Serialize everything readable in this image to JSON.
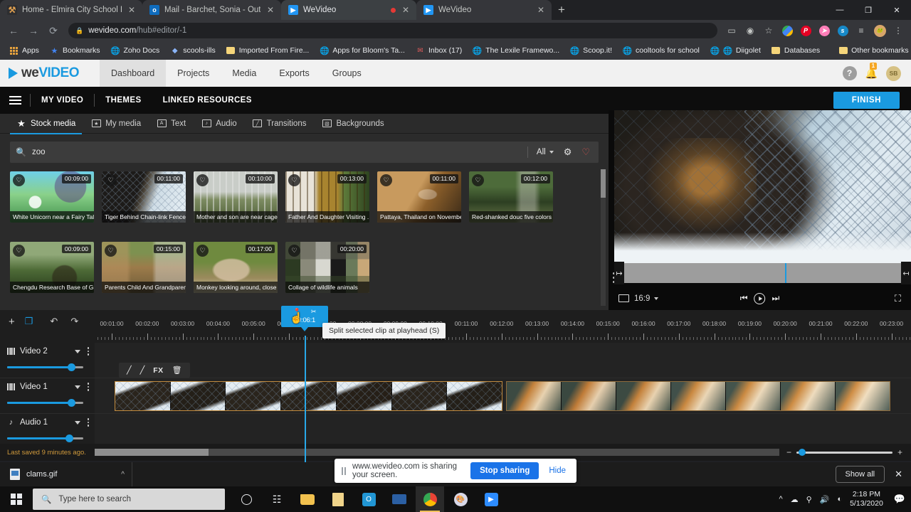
{
  "browser": {
    "tabs": [
      {
        "title": "Home - Elmira City School Distri",
        "favicon": "elmira-icon",
        "active": false,
        "recording": false
      },
      {
        "title": "Mail - Barchet, Sonia - Outlook",
        "favicon": "outlook-icon",
        "active": false,
        "recording": false
      },
      {
        "title": "WeVideo",
        "favicon": "wevideo-icon",
        "active": true,
        "recording": true
      },
      {
        "title": "WeVideo",
        "favicon": "wevideo-icon",
        "active": false,
        "recording": false
      }
    ],
    "new_tab_label": "+",
    "window_controls": {
      "minimize": "—",
      "maximize": "❐",
      "close": "✕"
    },
    "url_prefix": "wevideo.com",
    "url_suffix": "/hub#editor/-1",
    "bookmarks": [
      {
        "label": "Apps",
        "icon": "apps-grid-icon"
      },
      {
        "label": "Bookmarks",
        "icon": "star-icon"
      },
      {
        "label": "Zoho Docs",
        "icon": "globe-icon"
      },
      {
        "label": "scools-ills",
        "icon": "diamond-icon"
      },
      {
        "label": "Imported From Fire...",
        "icon": "folder-icon"
      },
      {
        "label": "Apps for Bloom's Ta...",
        "icon": "globe-icon"
      },
      {
        "label": "Inbox (17)",
        "icon": "mail-icon"
      },
      {
        "label": "The Lexile Framewo...",
        "icon": "globe-icon"
      },
      {
        "label": "Scoop.it!",
        "icon": "globe-icon"
      },
      {
        "label": "cooltools for school",
        "icon": "globe-icon"
      },
      {
        "label": "Diigolet",
        "icon": "globe-icon"
      },
      {
        "label": "Databases",
        "icon": "folder-icon"
      }
    ],
    "other_bookmarks": {
      "label": "Other bookmarks",
      "icon": "folder-icon"
    },
    "toolbar_extensions": [
      "cast-icon",
      "download-icon",
      "bookmark-star-icon",
      "google-drive-icon",
      "pinterest-icon",
      "pink-arrow-icon",
      "s-blue-icon",
      "list-icon",
      "profile-avatar-icon",
      "menu-dots-icon"
    ]
  },
  "wevideo": {
    "logo_we": "we",
    "logo_video": "VIDEO",
    "nav": [
      {
        "label": "Dashboard",
        "active": true
      },
      {
        "label": "Projects",
        "active": false
      },
      {
        "label": "Media",
        "active": false
      },
      {
        "label": "Exports",
        "active": false
      },
      {
        "label": "Groups",
        "active": false
      }
    ],
    "help_label": "?",
    "notification_count": "1",
    "avatar_initials": "SB",
    "subnav": [
      {
        "label": "MY VIDEO"
      },
      {
        "label": "THEMES"
      },
      {
        "label": "LINKED RESOURCES"
      }
    ],
    "finish_label": "FINISH",
    "media_tabs": [
      {
        "label": "Stock media",
        "icon": "star-icon",
        "active": true
      },
      {
        "label": "My media",
        "icon": "media-box-icon",
        "active": false
      },
      {
        "label": "Text",
        "icon": "text-a-icon",
        "active": false
      },
      {
        "label": "Audio",
        "icon": "music-note-icon",
        "active": false
      },
      {
        "label": "Transitions",
        "icon": "transitions-icon",
        "active": false
      },
      {
        "label": "Backgrounds",
        "icon": "image-icon",
        "active": false
      }
    ],
    "search": {
      "value": "zoo",
      "placeholder": "Search",
      "filter_label": "All",
      "icons": [
        "search-icon",
        "chevron-down-icon",
        "sliders-icon",
        "heart-icon"
      ]
    },
    "media_items": [
      {
        "title": "White Unicorn near a Fairy Tal...",
        "duration": "00:09:00"
      },
      {
        "title": "Tiger Behind Chain-link Fence",
        "duration": "00:11:00"
      },
      {
        "title": "Mother and son are near cage ...",
        "duration": "00:10:00"
      },
      {
        "title": "Father And Daughter Visiting ...",
        "duration": "00:13:00"
      },
      {
        "title": "Pattaya, Thailand on Novembe...",
        "duration": "00:11:00"
      },
      {
        "title": "Red-shanked douc five colors e...",
        "duration": "00:12:00"
      },
      {
        "title": "Chengdu Research Base of Gia...",
        "duration": "00:09:00"
      },
      {
        "title": "Parents Child And Grandparen...",
        "duration": "00:15:00"
      },
      {
        "title": "Monkey looking around, close ...",
        "duration": "00:17:00"
      },
      {
        "title": "Collage of wildlife animals",
        "duration": "00:20:00"
      }
    ],
    "preview": {
      "aspect_ratio": "16:9",
      "controls": [
        "prev-frame-icon",
        "play-icon",
        "next-frame-icon",
        "fullscreen-icon"
      ],
      "trim_in_icon": "trim-in-icon",
      "trim_out_icon": "trim-out-icon"
    },
    "timeline": {
      "toolbar_icons": [
        "add-icon",
        "duplicate-icon",
        "undo-icon",
        "redo-icon"
      ],
      "ruler_labels": [
        "00:01:00",
        "00:02:00",
        "00:03:00",
        "00:04:00",
        "00:05:00",
        "00:06:00",
        "00:07:00",
        "00:08:00",
        "00:09:00",
        "00:10:00",
        "00:11:00",
        "00:12:00",
        "00:13:00",
        "00:14:00",
        "00:15:00",
        "00:16:00",
        "00:17:00",
        "00:18:00",
        "00:19:00",
        "00:20:00",
        "00:21:00",
        "00:22:00",
        "00:23:00"
      ],
      "playhead_time": "00:06:1",
      "playhead_icons": [
        "marker-icon",
        "scissors-icon"
      ],
      "tooltip": "Split selected clip at playhead (S)",
      "tracks": [
        {
          "name": "Video 2",
          "icon": "video-track-icon",
          "volume": 78
        },
        {
          "name": "Video 1",
          "icon": "video-track-icon",
          "volume": 78
        },
        {
          "name": "Audio 1",
          "icon": "audio-track-icon",
          "volume": 76
        }
      ],
      "clip_toolbar": [
        "edit-pencil-icon",
        "trim-pencil-icon",
        "fx-label",
        "delete-trash-icon"
      ],
      "clip_fx_label": "FX",
      "saved_status": "Last saved 9 minutes ago.",
      "zoom_icons": [
        "zoom-out-icon",
        "zoom-in-icon"
      ]
    }
  },
  "share_bar": {
    "message": "www.wevideo.com is sharing your screen.",
    "stop_label": "Stop sharing",
    "hide_label": "Hide"
  },
  "downloads": {
    "file_name": "clams.gif",
    "show_all_label": "Show all",
    "close_label": "✕"
  },
  "taskbar": {
    "search_placeholder": "Type here to search",
    "apps": [
      "cortana-circle-icon",
      "task-view-icon",
      "file-explorer-icon",
      "notes-icon",
      "outlook-icon",
      "remote-desktop-icon",
      "chrome-icon",
      "paint-icon",
      "zoom-icon"
    ],
    "tray_icons": [
      "chevron-up-icon",
      "onedrive-icon",
      "hardware-icon",
      "volume-icon",
      "wifi-icon"
    ],
    "time": "2:18 PM",
    "date": "5/13/2020",
    "notification_icon": "action-center-icon"
  },
  "colors": {
    "accent_blue": "#1a9ae0",
    "chrome_blue": "#1a73e8",
    "panel_dark": "#2b2b2b",
    "header_light": "#f1f1f1",
    "saved_orange": "#d09a3c"
  }
}
